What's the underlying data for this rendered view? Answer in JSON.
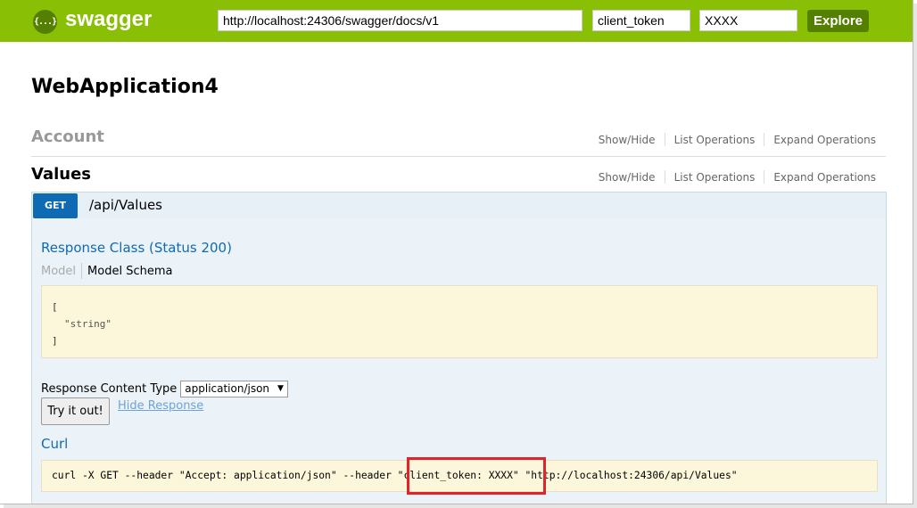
{
  "header": {
    "logo_icon": "{...}",
    "logo_text": "swagger",
    "url_value": "http://localhost:24306/swagger/docs/v1",
    "api_key_name": "client_token",
    "api_key_value": "XXXX",
    "explore_label": "Explore"
  },
  "page": {
    "title": "WebApplication4"
  },
  "resources": [
    {
      "name": "Account",
      "show_hide": "Show/Hide",
      "list_operations": "List Operations",
      "expand_operations": "Expand Operations"
    },
    {
      "name": "Values",
      "show_hide": "Show/Hide",
      "list_operations": "List Operations",
      "expand_operations": "Expand Operations"
    }
  ],
  "operation": {
    "method": "GET",
    "path": "/api/Values",
    "response_class": "Response Class (Status 200)",
    "model_tab": "Model",
    "model_schema_tab": "Model Schema",
    "schema_open": "[",
    "schema_item": "\"string\"",
    "schema_close": "]",
    "response_content_type_label": "Response Content Type",
    "response_content_type_value": "application/json",
    "try_it_label": "Try it out!",
    "hide_response_label": "Hide Response",
    "curl_title": "Curl",
    "curl_command": "curl -X GET --header \"Accept: application/json\" --header \"client_token: XXXX\" \"http://localhost:24306/api/Values\""
  },
  "colors": {
    "header_bg": "#89bf04",
    "brand_dark": "#547f00",
    "get_method": "#0f6ab4",
    "highlight": "#e0242a"
  },
  "icons": {
    "logo": "swagger-logo-icon",
    "select_caret": "caret-down-icon"
  }
}
